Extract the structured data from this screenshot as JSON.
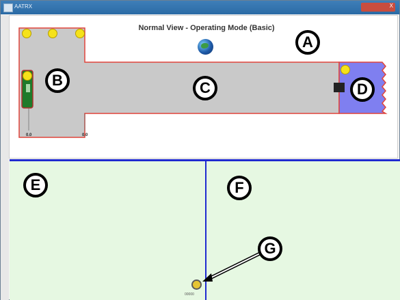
{
  "window": {
    "title": "AATRX",
    "controls_label": "X"
  },
  "view": {
    "title": "Normal View - Operating Mode (Basic)"
  },
  "markers": {
    "A": "A",
    "B": "B",
    "C": "C",
    "D": "D",
    "E": "E",
    "F": "F",
    "G": "G"
  },
  "scale_labels": [
    "0.0",
    "0.0"
  ],
  "bottom": {
    "tiny_label": "00000"
  },
  "colors": {
    "pane_bg": "#e6f8e2",
    "divider": "#1f2ad1",
    "tank_fill": "#c9c9c9",
    "tank_border": "#e0443a",
    "d_block": "#7f7ff0",
    "indicator_yellow": "#f5e21a"
  }
}
